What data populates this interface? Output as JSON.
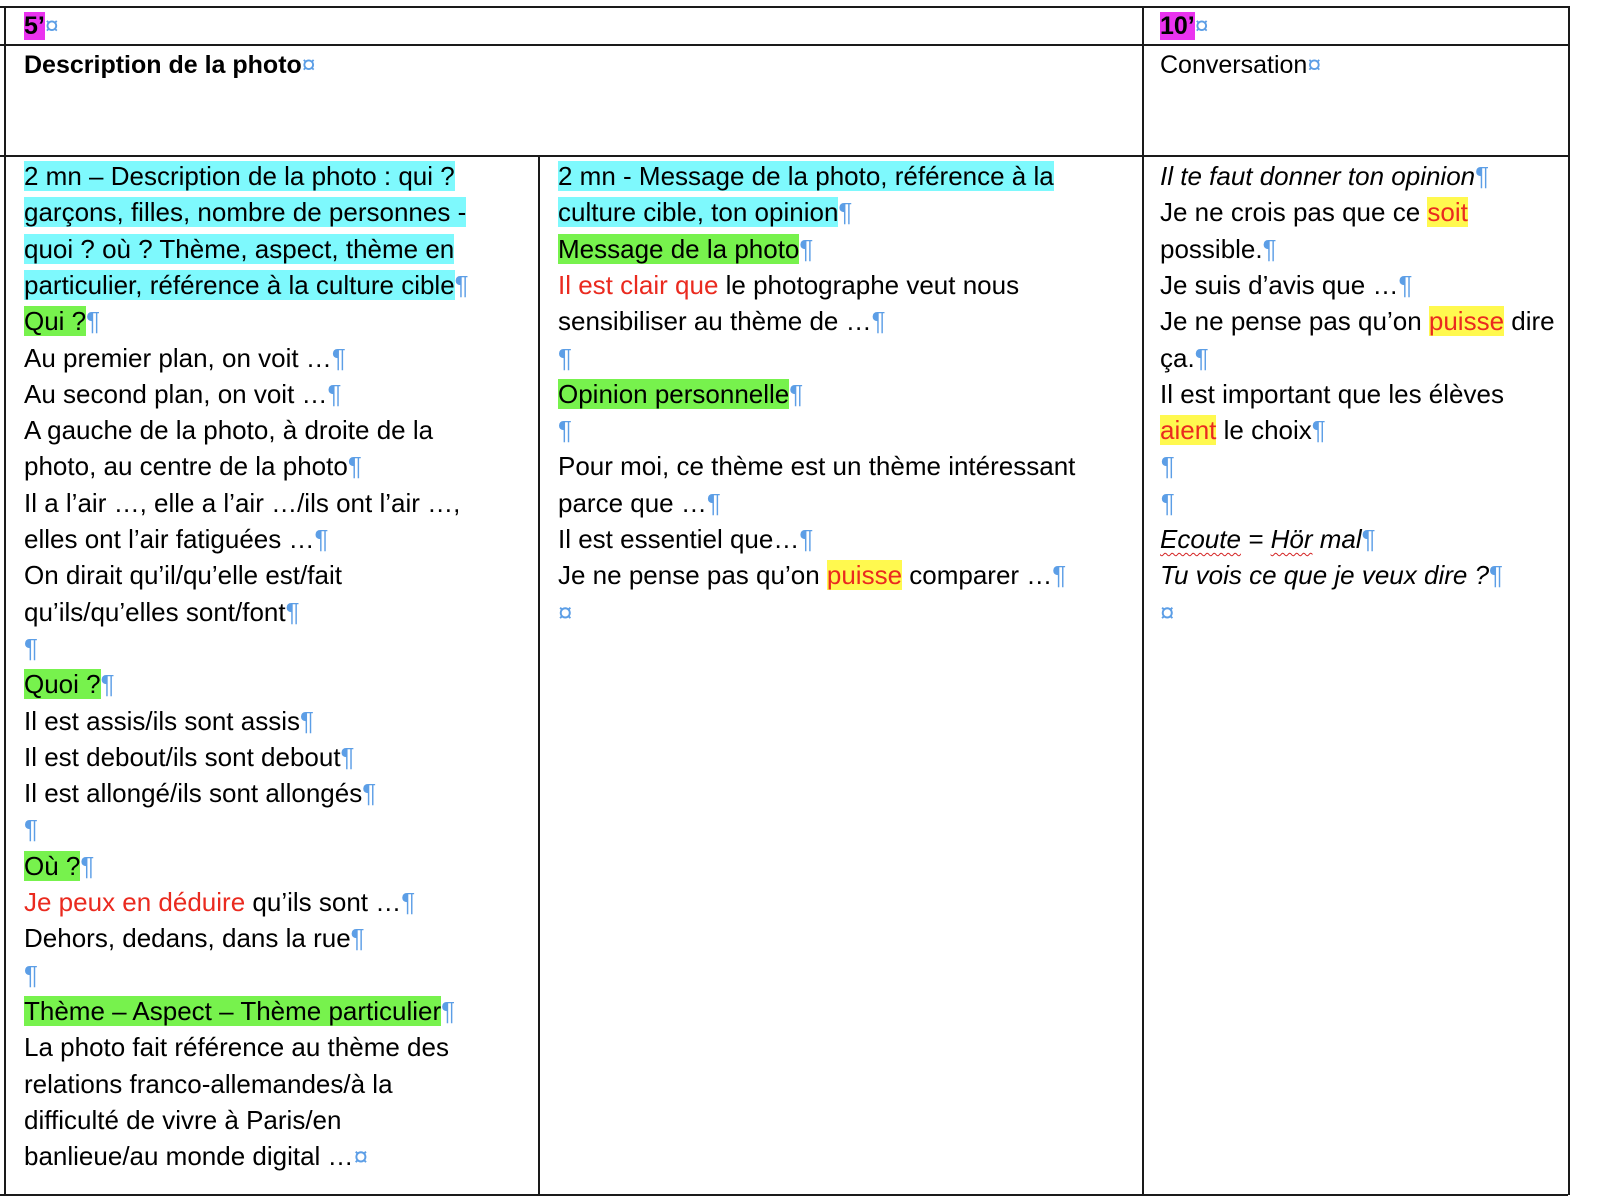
{
  "colors": {
    "cyan_highlight": "#7ef9fd",
    "green_highlight": "#77f24d",
    "yellow_highlight": "#fff94f",
    "magenta_highlight": "#ea33ef",
    "red_text": "#ea2a1f",
    "formatting_marks": "#5c9ee6"
  },
  "formatting_marks": {
    "pilcrow": "¶",
    "cell_end": "¤"
  },
  "header": {
    "left_time": "5’",
    "right_time": "10’",
    "left_title": "Description de la photo",
    "right_title": "Conversation"
  },
  "col1": {
    "lines": [
      [
        {
          "t": "2 mn – Description de la photo : qui ?",
          "s": "hl-cyan"
        }
      ],
      [
        {
          "t": "garçons, filles, nombre de personnes -",
          "s": "hl-cyan"
        }
      ],
      [
        {
          "t": "quoi ? où ? Thème, aspect, thème en",
          "s": "hl-cyan"
        }
      ],
      [
        {
          "t": "particulier, référence à la culture cible",
          "s": "hl-cyan"
        },
        {
          "t": "¶",
          "s": "mk"
        }
      ],
      [
        {
          "t": "Qui ?",
          "s": "hl-green"
        },
        {
          "t": "¶",
          "s": "mk"
        }
      ],
      [
        {
          "t": "Au premier plan, on voit …"
        },
        {
          "t": "¶",
          "s": "mk"
        }
      ],
      [
        {
          "t": "Au second plan, on voit …"
        },
        {
          "t": "¶",
          "s": "mk"
        }
      ],
      [
        {
          "t": "A gauche de la photo, à droite de la"
        }
      ],
      [
        {
          "t": "photo, au centre de la photo"
        },
        {
          "t": "¶",
          "s": "mk"
        }
      ],
      [
        {
          "t": "Il a l’air …, elle a l’air …/ils ont l’air …,"
        }
      ],
      [
        {
          "t": "elles ont l’air fatiguées …"
        },
        {
          "t": "¶",
          "s": "mk"
        }
      ],
      [
        {
          "t": "On dirait qu’il/qu’elle est/fait"
        }
      ],
      [
        {
          "t": "qu’ils/qu’elles sont/font"
        },
        {
          "t": "¶",
          "s": "mk"
        }
      ],
      [
        {
          "t": "¶",
          "s": "mk"
        }
      ],
      [
        {
          "t": "Quoi ?",
          "s": "hl-green"
        },
        {
          "t": "¶",
          "s": "mk"
        }
      ],
      [
        {
          "t": "Il est assis/ils sont assis"
        },
        {
          "t": "¶",
          "s": "mk"
        }
      ],
      [
        {
          "t": "Il est debout/ils sont debout"
        },
        {
          "t": "¶",
          "s": "mk"
        }
      ],
      [
        {
          "t": "Il est allongé/ils sont allongés"
        },
        {
          "t": "¶",
          "s": "mk"
        }
      ],
      [
        {
          "t": "¶",
          "s": "mk"
        }
      ],
      [
        {
          "t": "Où ?",
          "s": "hl-green"
        },
        {
          "t": "¶",
          "s": "mk"
        }
      ],
      [
        {
          "t": "Je peux en déduire",
          "s": "red"
        },
        {
          "t": " qu’ils sont …"
        },
        {
          "t": "¶",
          "s": "mk"
        }
      ],
      [
        {
          "t": "Dehors, dedans, dans la rue"
        },
        {
          "t": "¶",
          "s": "mk"
        }
      ],
      [
        {
          "t": "¶",
          "s": "mk"
        }
      ],
      [
        {
          "t": "Thème – Aspect – Thème particulier",
          "s": "hl-green"
        },
        {
          "t": "¶",
          "s": "mk"
        }
      ],
      [
        {
          "t": "La photo fait référence au thème des"
        }
      ],
      [
        {
          "t": "relations franco-allemandes/à la"
        }
      ],
      [
        {
          "t": "difficulté de vivre à Paris/en"
        }
      ],
      [
        {
          "t": "banlieue/au monde digital …"
        },
        {
          "t": "¤",
          "s": "mk"
        }
      ]
    ]
  },
  "col2": {
    "lines": [
      [
        {
          "t": "2 mn - Message de la photo, référence à la",
          "s": "hl-cyan"
        }
      ],
      [
        {
          "t": "culture cible, ton opinion",
          "s": "hl-cyan"
        },
        {
          "t": "¶",
          "s": "mk"
        }
      ],
      [
        {
          "t": "Message de la photo",
          "s": "hl-green"
        },
        {
          "t": "¶",
          "s": "mk"
        }
      ],
      [
        {
          "t": "Il est clair que",
          "s": "red"
        },
        {
          "t": " le photographe veut nous"
        }
      ],
      [
        {
          "t": "sensibiliser au thème de …"
        },
        {
          "t": "¶",
          "s": "mk"
        }
      ],
      [
        {
          "t": "¶",
          "s": "mk"
        }
      ],
      [
        {
          "t": "Opinion personnelle",
          "s": "hl-green"
        },
        {
          "t": "¶",
          "s": "mk"
        }
      ],
      [
        {
          "t": "¶",
          "s": "mk"
        }
      ],
      [
        {
          "t": "Pour moi, ce thème est un thème intéressant"
        }
      ],
      [
        {
          "t": "parce que …"
        },
        {
          "t": "¶",
          "s": "mk"
        }
      ],
      [
        {
          "t": "Il est essentiel que…"
        },
        {
          "t": "¶",
          "s": "mk"
        }
      ],
      [
        {
          "t": "Je ne pense pas qu’on "
        },
        {
          "t": "puisse",
          "s": "hl-yellow red"
        },
        {
          "t": " comparer …"
        },
        {
          "t": "¶",
          "s": "mk"
        }
      ],
      [
        {
          "t": "¤",
          "s": "mk"
        }
      ]
    ]
  },
  "col3": {
    "lines": [
      [
        {
          "t": "Il te faut donner ton opinion",
          "s": "i"
        },
        {
          "t": "¶",
          "s": "mk"
        }
      ],
      [
        {
          "t": "Je ne crois pas que ce "
        },
        {
          "t": "soit",
          "s": "hl-yellow red"
        }
      ],
      [
        {
          "t": "possible."
        },
        {
          "t": "¶",
          "s": "mk"
        }
      ],
      [
        {
          "t": "Je suis d’avis que …"
        },
        {
          "t": "¶",
          "s": "mk"
        }
      ],
      [
        {
          "t": "Je ne pense pas qu’on "
        },
        {
          "t": "puisse",
          "s": "hl-yellow red"
        },
        {
          "t": " dire"
        }
      ],
      [
        {
          "t": "ça."
        },
        {
          "t": "¶",
          "s": "mk"
        }
      ],
      [
        {
          "t": "Il est important que les élèves"
        }
      ],
      [
        {
          "t": "aient",
          "s": "hl-yellow red"
        },
        {
          "t": " le choix"
        },
        {
          "t": "¶",
          "s": "mk"
        }
      ],
      [
        {
          "t": "¶",
          "s": "mk i"
        }
      ],
      [
        {
          "t": "¶",
          "s": "mk i"
        }
      ],
      [
        {
          "t": "Ecoute",
          "s": "i squig"
        },
        {
          "t": " = ",
          "s": "i"
        },
        {
          "t": "Hör",
          "s": "i squig"
        },
        {
          "t": " mal",
          "s": "i"
        },
        {
          "t": "¶",
          "s": "mk"
        }
      ],
      [
        {
          "t": "Tu vois ce que je veux dire ?",
          "s": "i"
        },
        {
          "t": "¶",
          "s": "mk"
        }
      ],
      [
        {
          "t": "¤",
          "s": "mk"
        }
      ]
    ]
  }
}
